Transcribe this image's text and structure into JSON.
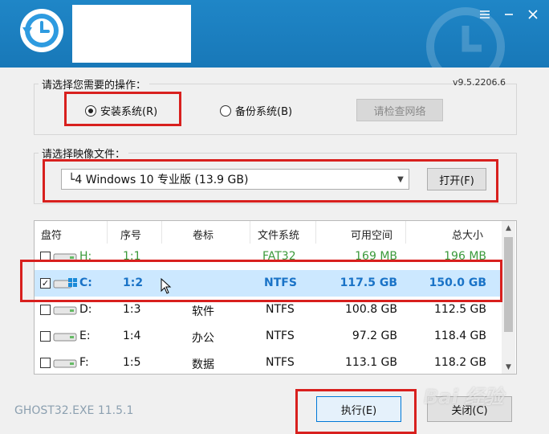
{
  "header": {
    "logo_icon": "clock-restore-icon",
    "bg_icon": "clock-restore-icon",
    "accent": "#1a7dbf"
  },
  "window_buttons": {
    "menu": "≡",
    "minimize": "—",
    "close": "✕"
  },
  "operation": {
    "label": "请选择您需要的操作：",
    "version": "v9.5.2206.6",
    "install_label": "安装系统(R)",
    "install_selected": true,
    "backup_label": "备份系统(B)",
    "backup_selected": false,
    "network_button": "请检查网络"
  },
  "image": {
    "label": "请选择映像文件：",
    "selected": "└4 Windows 10 专业版 (13.9 GB)",
    "open_button": "打开(F)"
  },
  "table": {
    "columns": [
      "盘符",
      "序号",
      "卷标",
      "文件系统",
      "可用空间",
      "总大小"
    ],
    "rows": [
      {
        "checked": false,
        "drive": "H:",
        "index": "1:1",
        "label": "",
        "fs": "FAT32",
        "free": "169 MB",
        "total": "196 MB",
        "style": "green"
      },
      {
        "checked": true,
        "drive": "C:",
        "index": "1:2",
        "label": "",
        "fs": "NTFS",
        "free": "117.5 GB",
        "total": "150.0 GB",
        "style": "selected"
      },
      {
        "checked": false,
        "drive": "D:",
        "index": "1:3",
        "label": "软件",
        "fs": "NTFS",
        "free": "100.8 GB",
        "total": "112.5 GB",
        "style": "normal"
      },
      {
        "checked": false,
        "drive": "E:",
        "index": "1:4",
        "label": "办公",
        "fs": "NTFS",
        "free": "97.2 GB",
        "total": "118.4 GB",
        "style": "normal"
      },
      {
        "checked": false,
        "drive": "F:",
        "index": "1:5",
        "label": "数据",
        "fs": "NTFS",
        "free": "113.1 GB",
        "total": "118.2 GB",
        "style": "normal"
      }
    ]
  },
  "footer": {
    "ghost_version": "GHOST32.EXE 11.5.1",
    "execute_button": "执行(E)",
    "close_button": "关闭(C)",
    "watermark": "Bai 经验"
  },
  "colors": {
    "highlight": "#d8201e",
    "selected_row": "#cce8ff",
    "green_text": "#3b9a3b",
    "blue_text": "#1a73c7"
  }
}
